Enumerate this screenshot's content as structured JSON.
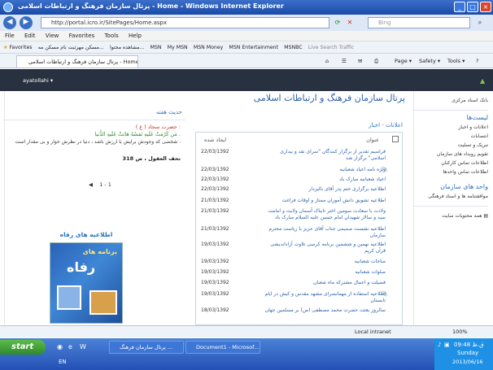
{
  "window": {
    "title": "پرتال سازمان فرهنگ و ارتباطات اسلامی - Home - Windows Internet Explorer"
  },
  "address": {
    "url": "http://portal.icro.ir/SitePages/Home.aspx",
    "search_placeholder": "Bing"
  },
  "menu": [
    "File",
    "Edit",
    "View",
    "Favorites",
    "Tools",
    "Help"
  ],
  "favorites": {
    "label": "Favorites",
    "items": [
      "مسکن مهرثبت نام مسکن مه...",
      "مشاهده محتوا...",
      "MSN",
      "My MSN",
      "MSN Money",
      "MSN Entertainment",
      "MSNBC",
      "Live Search Traffic"
    ]
  },
  "tab": {
    "label": "پرتال سازمان فرهنگ و ارتباطات اسلامی - Home",
    "page_menu": "Page ▾",
    "safety_menu": "Safety ▾",
    "tools_menu": "Tools ▾"
  },
  "portal": {
    "user": "ayatollahi ▾",
    "site_title": "پرتال سازمان فرهنگ و ارتباطات اسلامی",
    "quick_launch": {
      "top_item": "بانک اسناد مرکزی",
      "lists_title": "لیست‌ها",
      "lists": [
        "اعلانات و اخبار",
        "انتصابات",
        "تبریک و تسلیت",
        "تقویم رویداد های سازمان",
        "اطلاعات تماس کارکنان",
        "اطلاعات تماس واحدها"
      ],
      "units_title": "واحد های سازمان",
      "units": [
        "موافقتنامه ها و اسناد فرهنگی"
      ],
      "all_content": "همه محتویات سایت"
    },
    "announcements": {
      "header": "اعلانات - اخبار",
      "col_title": "عنوان",
      "col_created": "ایجاد شده",
      "rows": [
        {
          "title": "فراسیم تقدیر از برگزار کنندگان \"سرای نقد و بیداری اسلامی\" برگزار شد",
          "date": "22/03/1392",
          "attach": false
        },
        {
          "title": "ویژه نامه اعیاد شعبانیه",
          "date": "22/03/1392",
          "attach": true
        },
        {
          "title": "اعیاد شعبانیه مبارک باد",
          "date": "22/03/1392",
          "attach": false
        },
        {
          "title": "اطلاعیه برگزاری ختم پدر آقای بالیزدار",
          "date": "22/03/1392",
          "attach": false
        },
        {
          "title": "اطلاعیه تشویق دانش آموزان ممتاز و اوقات فراغت",
          "date": "21/03/1392",
          "attach": false
        },
        {
          "title": "ولادت با سعادت سومین اختر تابناک آسمان ولایت و امامت سید و سالار شهیدان امام حسین علیه السلام مبارک باد",
          "date": "21/03/1392",
          "attach": false
        },
        {
          "title": "اطلاعیه نشست صمیمی جناب آقای عزیز با ریاست محترم سازمان",
          "date": "21/03/1392",
          "attach": false
        },
        {
          "title": "اطلاعیه نهمین و ششمین برنامه کرسی تلاوت آزاداندیشی قرآن کریم",
          "date": "19/03/1392",
          "attach": false
        },
        {
          "title": "مناجات شعبانیه",
          "date": "19/03/1392",
          "attach": false
        },
        {
          "title": "صلوات شعبانیه",
          "date": "19/03/1392",
          "attach": false
        },
        {
          "title": "فضیلت و اعمال مشترکه ماه شعبان",
          "date": "19/03/1392",
          "attach": false
        },
        {
          "title": "اطلاعیه استفاده از مهمانسرای مشهد مقدس و کیش در ایام تابستان",
          "date": "19/03/1392",
          "attach": true
        },
        {
          "title": "سالروز بعثت حضرت محمد مصطفی (ص) بر مسلمین جهان",
          "date": "18/03/1392",
          "attach": false
        }
      ]
    },
    "hadith": {
      "title": "حدیث هفته",
      "author": "حضرت سجاد ( ع ) :",
      "arabic": "مَن كَرُمَتْ عَلَيهِ نَفسُهُ هانَتْ عَلَيهِ الدُّنيا .",
      "persian": "شخصی که وجودش برایش با ارزش باشد ، دنیا در نظرش خوار و بی مقدار است .",
      "source": "تحف العقول ، ص 318",
      "pager": "1 - 1"
    },
    "refah": {
      "title": "اطلاعیه های رفاه",
      "banner_text": "برنامه های",
      "banner_logo": "رفاه"
    }
  },
  "status": {
    "zone": "Local intranet",
    "zoom": "100%"
  },
  "taskbar": {
    "start": "start",
    "items": [
      "پرتال سازمان فرهنگ ...",
      "Document1 - Microsof..."
    ],
    "language": "EN",
    "time": "09:48 ق.ظ",
    "day": "Sunday",
    "date": "2013/06/16"
  },
  "colors": {
    "titlebar": "#1a4aa8",
    "portal_header": "#27313f",
    "link": "#2b5fa8",
    "section": "#2b70c0"
  }
}
